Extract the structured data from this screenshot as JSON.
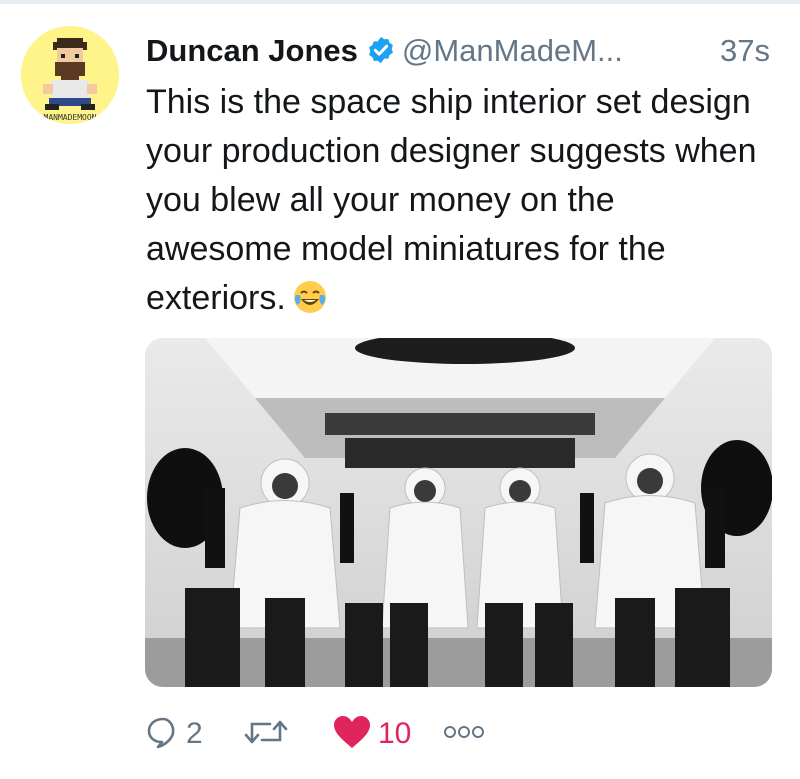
{
  "tweet": {
    "author_name": "Duncan Jones",
    "handle": "@ManMadeM...",
    "timestamp": "37s",
    "verified_icon": "verified-badge-icon",
    "text": "This is the space ship interior set design your production designer suggests when you blew all your money on the awesome model miniatures for the exteriors.",
    "emoji": "face-with-tears-of-joy",
    "avatar_caption": "MANMADEMOON",
    "media": {
      "kind": "photo",
      "alt": "Four astronauts in white spacesuits seated in a spacecraft cabin"
    }
  },
  "actions": {
    "reply": {
      "icon": "reply-icon",
      "count": "2"
    },
    "retweet": {
      "icon": "retweet-icon",
      "count": ""
    },
    "like": {
      "icon": "heart-icon",
      "count": "10",
      "color": "#e0245e"
    },
    "more": {
      "icon": "more-icon"
    }
  },
  "colors": {
    "text": "#14171a",
    "secondary": "#657786",
    "verified": "#1da1f2",
    "like": "#e0245e",
    "avatar_bg": "#fff48a"
  }
}
